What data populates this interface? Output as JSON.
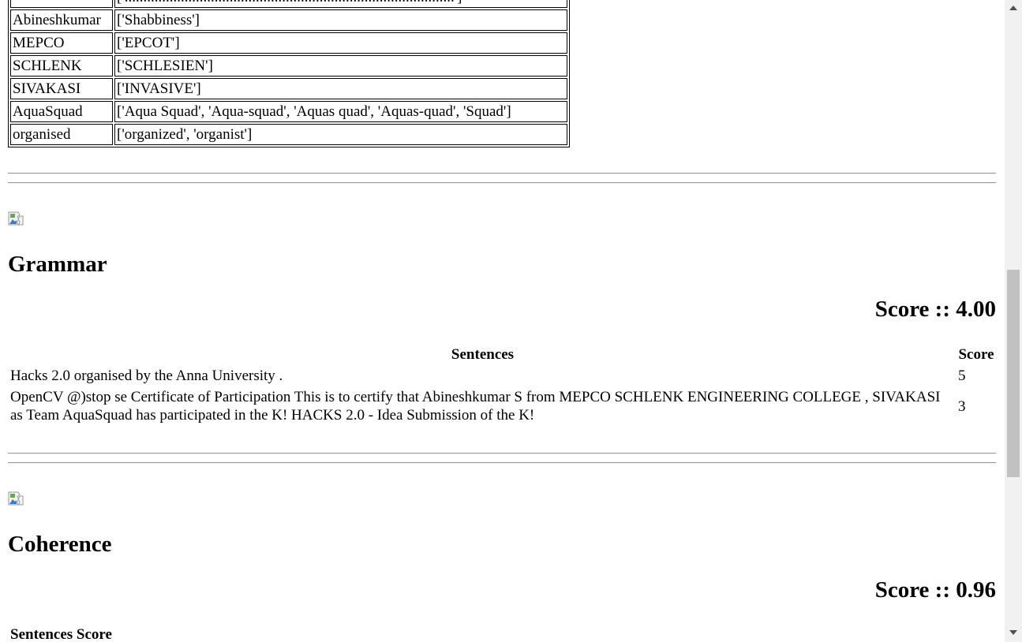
{
  "spelling": {
    "rows": [
      {
        "word": "",
        "suggestions": "['........................................................................................']"
      },
      {
        "word": "Abineshkumar",
        "suggestions": "['Shabbiness']"
      },
      {
        "word": "MEPCO",
        "suggestions": "['EPCOT']"
      },
      {
        "word": "SCHLENK",
        "suggestions": "['SCHLESIEN']"
      },
      {
        "word": "SIVAKASI",
        "suggestions": "['INVASIVE']"
      },
      {
        "word": "AquaSquad",
        "suggestions": "['Aqua Squad', 'Aqua-squad', 'Aquas quad', 'Aquas-quad', 'Squad']"
      },
      {
        "word": "organised",
        "suggestions": "['organized', 'organist']"
      }
    ]
  },
  "grammar": {
    "title": "Grammar",
    "score_text": "Score :: 4.00",
    "headers": {
      "sentences": "Sentences",
      "score": "Score"
    },
    "rows": [
      {
        "sentence": "Hacks 2.0 organised by the Anna University .",
        "score": "5"
      },
      {
        "sentence": "OpenCV @)stop se Certificate of Participation This is to certify that Abineshkumar S from MEPCO SCHLENK ENGINEERING COLLEGE , SIVAKASI as Team AquaSquad has participated in the K! HACKS 2.0 - Idea Submission of the K!",
        "score": "3"
      }
    ]
  },
  "coherence": {
    "title": "Coherence",
    "score_text": "Score :: 0.96",
    "header_text": "Sentences Score"
  },
  "icons": {
    "broken_image": "broken-image-icon",
    "scroll_up": "arrow-up-icon",
    "scroll_down": "arrow-down-icon"
  }
}
